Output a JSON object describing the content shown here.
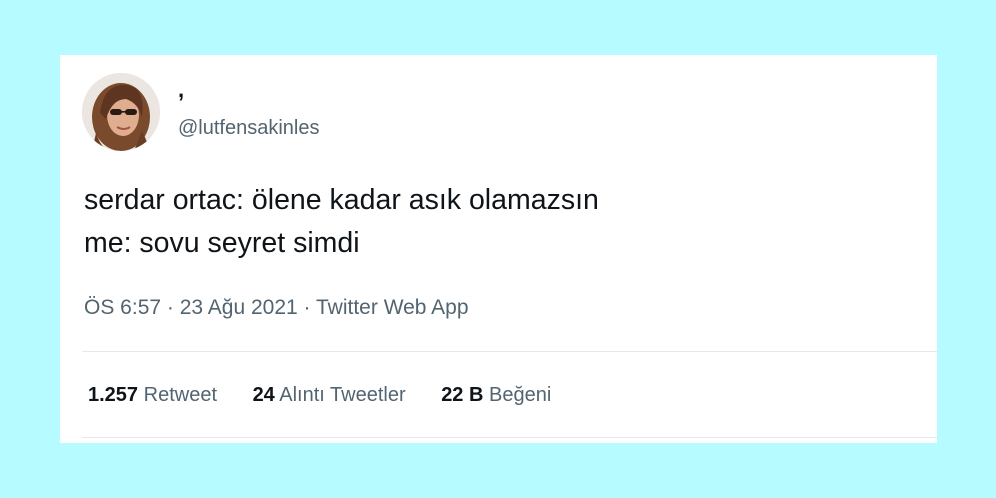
{
  "tweet": {
    "display_name": ",",
    "handle": "@lutfensakinles",
    "text": "serdar ortac: ölene kadar asık olamazsın\nme: sovu seyret simdi",
    "time": "ÖS 6:57",
    "date": "23 Ağu 2021",
    "source": "Twitter Web App",
    "separator": "·",
    "stats": [
      {
        "count": "1.257",
        "label": "Retweet"
      },
      {
        "count": "24",
        "label": "Alıntı Tweetler"
      },
      {
        "count": "22 B",
        "label": "Beğeni"
      }
    ]
  },
  "colors": {
    "background": "#b6fbff",
    "card": "#ffffff",
    "text_primary": "#0f1419",
    "text_secondary": "#536471"
  }
}
